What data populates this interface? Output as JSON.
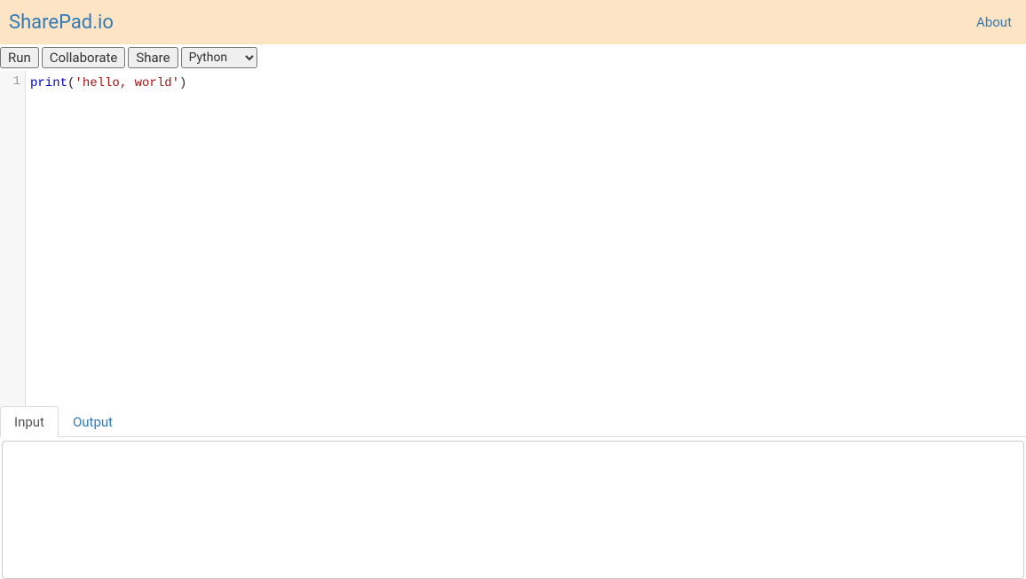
{
  "header": {
    "brand": "SharePad.io",
    "about_label": "About"
  },
  "toolbar": {
    "run_label": "Run",
    "collaborate_label": "Collaborate",
    "share_label": "Share",
    "language_selected": "Python"
  },
  "editor": {
    "line_number": "1",
    "code": {
      "keyword": "print",
      "open_paren": "(",
      "string": "'hello, world'",
      "close_paren": ")"
    }
  },
  "tabs": {
    "input_label": "Input",
    "output_label": "Output"
  },
  "io_panel": {
    "content": ""
  }
}
